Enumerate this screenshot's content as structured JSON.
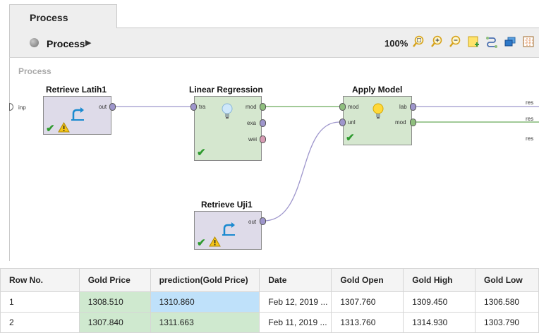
{
  "tabs": [
    {
      "label": "Process"
    }
  ],
  "breadcrumb": {
    "label": "Process"
  },
  "toolbar": {
    "zoom": "100%",
    "icons": [
      "zoom-fit-icon",
      "zoom-in-icon",
      "zoom-out-icon",
      "add-note-icon",
      "auto-wire-icon",
      "layers-icon",
      "grid-icon"
    ]
  },
  "canvas": {
    "title": "Process",
    "input_port": "inp",
    "result_ports": [
      "res",
      "res",
      "res"
    ],
    "operators": {
      "retrieve_latih": {
        "title": "Retrieve Latih1",
        "ports_out": [
          "out"
        ]
      },
      "linear_regression": {
        "title": "Linear Regression",
        "ports_in": [
          "tra"
        ],
        "ports_out": [
          "mod",
          "exa",
          "wei"
        ]
      },
      "apply_model": {
        "title": "Apply Model",
        "ports_in": [
          "mod",
          "unl"
        ],
        "ports_out": [
          "lab",
          "mod"
        ]
      },
      "retrieve_uji": {
        "title": "Retrieve Uji1",
        "ports_out": [
          "out"
        ]
      }
    }
  },
  "table": {
    "columns": [
      "Row No.",
      "Gold Price",
      "prediction(Gold Price)",
      "Date",
      "Gold Open",
      "Gold High",
      "Gold Low"
    ],
    "rows": [
      [
        "1",
        "1308.510",
        "1310.860",
        "Feb 12, 2019 ...",
        "1307.760",
        "1309.450",
        "1306.580"
      ],
      [
        "2",
        "1307.840",
        "1311.663",
        "Feb 11, 2019 ...",
        "1313.760",
        "1314.930",
        "1303.790"
      ]
    ]
  },
  "colors": {
    "retrieve_operator": "#dedbe9",
    "model_operator": "#d5e7cf",
    "wire_purple": "#9e96cc",
    "wire_green": "#6aaa5a",
    "gold_price_cell": "#cfe9cf",
    "prediction_cell": "#bfe1fa"
  }
}
